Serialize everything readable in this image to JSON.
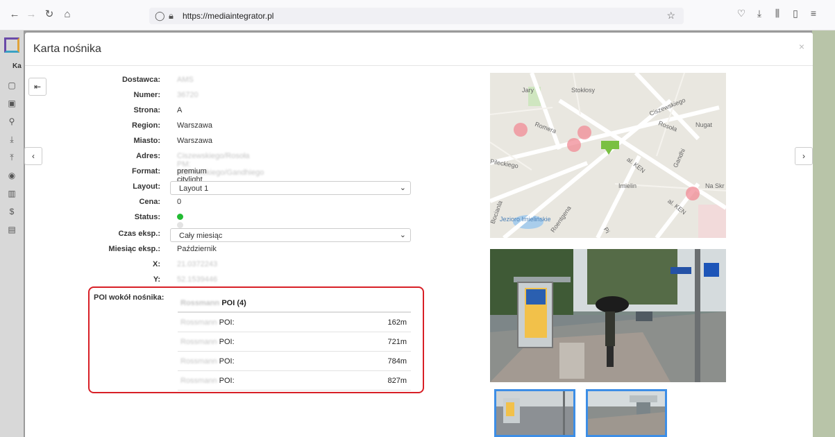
{
  "browser": {
    "url": "https://mediaintegrator.pl",
    "icons": [
      "back-icon",
      "forward-icon",
      "reload-icon",
      "home-icon",
      "shield-icon",
      "lock-icon",
      "star-icon",
      "pocket-icon",
      "download-icon",
      "library-icon",
      "sidebar-icon",
      "menu-icon"
    ]
  },
  "app": {
    "partial_label": "Ka"
  },
  "modal": {
    "title": "Karta nośnika",
    "close": "×"
  },
  "fields": {
    "dostawca": {
      "label": "Dostawca:",
      "value": "AMS"
    },
    "numer": {
      "label": "Numer:",
      "value": "36720"
    },
    "strona": {
      "label": "Strona:",
      "value": "A"
    },
    "region": {
      "label": "Region:",
      "value": "Warszawa"
    },
    "miasto": {
      "label": "Miasto:",
      "value": "Warszawa"
    },
    "adres": {
      "label": "Adres:",
      "value": "Ciszewskiego/Rosoła PM: SOFNeckiego/Gandhiego (A)"
    },
    "format": {
      "label": "Format:",
      "value": "premium citylight"
    },
    "layout": {
      "label": "Layout:",
      "value": "Layout 1"
    },
    "cena": {
      "label": "Cena:",
      "value": "0"
    },
    "status": {
      "label": "Status:"
    },
    "czas": {
      "label": "Czas eksp.:",
      "value": "Cały miesiąc"
    },
    "miesiac": {
      "label": "Miesiąc eksp.:",
      "value": "Październik"
    },
    "x": {
      "label": "X:",
      "value": "21.0372243"
    },
    "y": {
      "label": "Y:",
      "value": "52.1539446"
    }
  },
  "poi": {
    "label": "POI wokół nośnika:",
    "header_blur": "Rossmann",
    "header": "POI (4)",
    "rows": [
      {
        "blur": "Rossmann",
        "name": "POI:",
        "dist": "162m"
      },
      {
        "blur": "Rossmann",
        "name": "POI:",
        "dist": "721m"
      },
      {
        "blur": "Rossmann",
        "name": "POI:",
        "dist": "784m"
      },
      {
        "blur": "Rossmann",
        "name": "POI:",
        "dist": "827m"
      }
    ]
  },
  "map": {
    "labels": [
      "Jary",
      "Stokłosy",
      "Ciszewskiego",
      "Romera",
      "Rosoła",
      "Nugat",
      "Pileckiego",
      "al. KEN",
      "Gandhi",
      "Imielin",
      "Na Skr",
      "al. KEN",
      "Bocianla",
      "Jezioro Imielińskie",
      "Roentgena",
      "Pi"
    ]
  },
  "status_colors": {
    "active": "#22bb33",
    "inactive": "#e3e3e3"
  },
  "accent": "#3d8ee6",
  "highlight": "#d81f26"
}
